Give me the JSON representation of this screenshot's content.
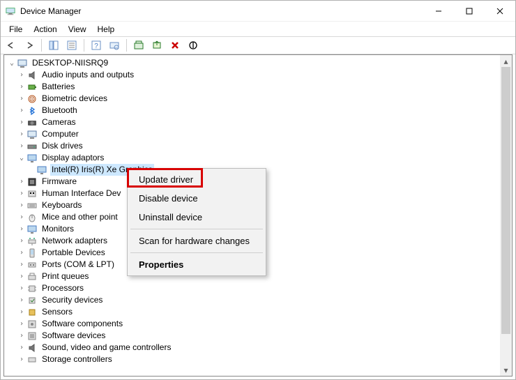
{
  "window": {
    "title": "Device Manager"
  },
  "menu": {
    "file": "File",
    "action": "Action",
    "view": "View",
    "help": "Help"
  },
  "tree": {
    "root": "DESKTOP-NIISRQ9",
    "audio": "Audio inputs and outputs",
    "batteries": "Batteries",
    "biometric": "Biometric devices",
    "bluetooth": "Bluetooth",
    "cameras": "Cameras",
    "computer": "Computer",
    "disks": "Disk drives",
    "display": "Display adaptors",
    "display_child": "Intel(R) Iris(R) Xe Graphics",
    "firmware": "Firmware",
    "hid": "Human Interface Dev",
    "keyboards": "Keyboards",
    "mice": "Mice and other point",
    "monitors": "Monitors",
    "network": "Network adapters",
    "portable": "Portable Devices",
    "ports": "Ports (COM & LPT)",
    "printq": "Print queues",
    "processors": "Processors",
    "security": "Security devices",
    "sensors": "Sensors",
    "swcomp": "Software components",
    "swdev": "Software devices",
    "sound": "Sound, video and game controllers",
    "storage": "Storage controllers"
  },
  "context_menu": {
    "update": "Update driver",
    "disable": "Disable device",
    "uninstall": "Uninstall device",
    "scan": "Scan for hardware changes",
    "properties": "Properties"
  }
}
